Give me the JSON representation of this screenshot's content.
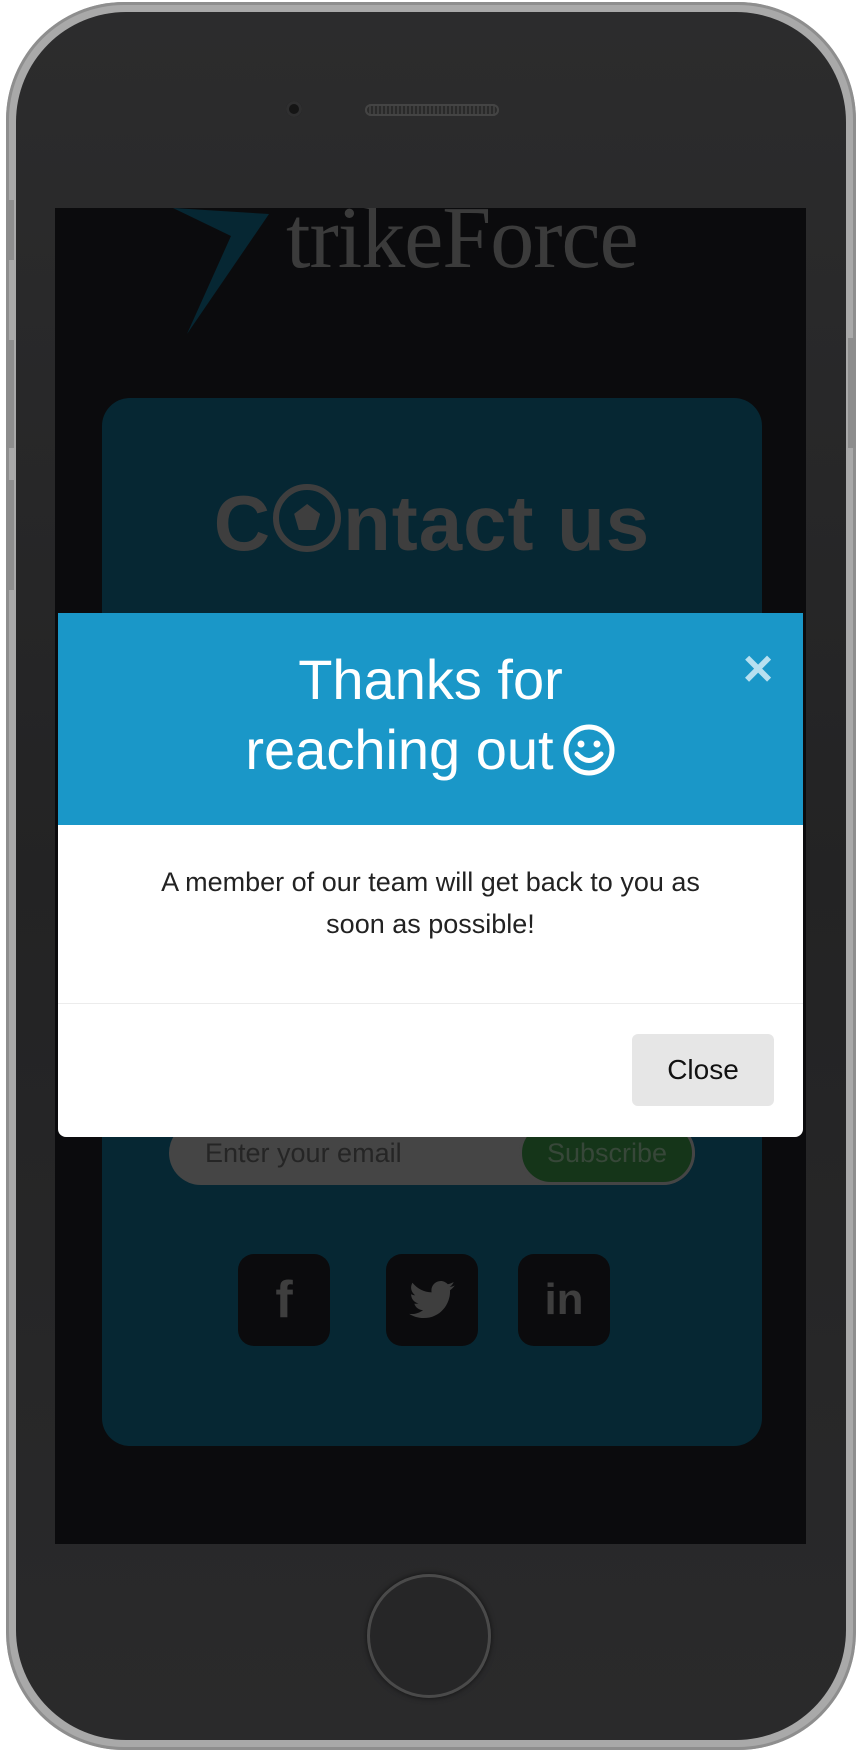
{
  "site": {
    "logo_text": "trikeForce",
    "contact_title_left": "C",
    "contact_title_right": "ntact us"
  },
  "subscribe": {
    "placeholder": "Enter your email",
    "button_label": "Subscribe"
  },
  "social": [
    {
      "icon": "facebook-icon",
      "glyph": "f"
    },
    {
      "icon": "twitter-icon"
    },
    {
      "icon": "linkedin-icon",
      "glyph": "in"
    }
  ],
  "modal": {
    "title_line1": "Thanks for",
    "title_line2": "reaching out",
    "title_icon": "smiley-icon",
    "close_icon": "×",
    "message": "A member of our team will get back to you as soon as possible!",
    "close_label": "Close"
  },
  "colors": {
    "modal_header": "#1a97c8",
    "card": "#0d4f67",
    "subscribe_button": "#2b6a32",
    "screen_bg": "#16171b"
  }
}
